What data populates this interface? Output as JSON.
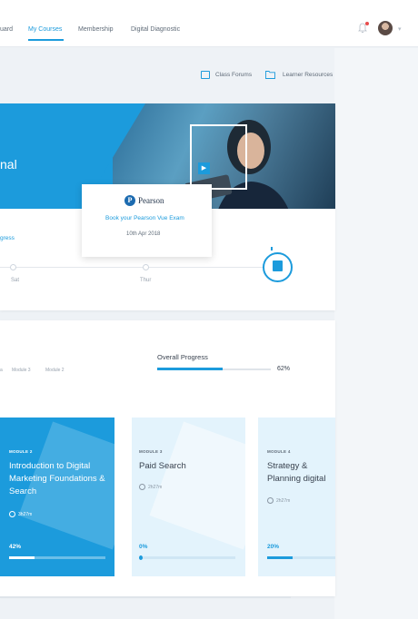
{
  "nav": {
    "items": [
      {
        "label": "uard",
        "active": false
      },
      {
        "label": "My Courses",
        "active": true
      },
      {
        "label": "Membership",
        "active": false
      },
      {
        "label": "Digital Diagnostic",
        "active": false
      }
    ]
  },
  "resources": {
    "class_forums": "Class Forums",
    "learner_resources": "Learner Resources"
  },
  "hero": {
    "title": "nal"
  },
  "exam_popup": {
    "brand": "Pearson",
    "link": "Book your Pearson Vue Exam",
    "date": "10th Apr 2018"
  },
  "timeline": {
    "label": "gress",
    "points": [
      "Sat",
      "Thur"
    ]
  },
  "overall": {
    "label": "Overall Progress",
    "value": 62,
    "percent": "62%",
    "tabs": [
      "Module 3",
      "Module 2"
    ]
  },
  "modules": [
    {
      "module": "MODULE 2",
      "title": "Introduction to Digital Marketing Foundations & Search",
      "duration": "3h27m",
      "percent": "42%",
      "progress": 0.42
    },
    {
      "module": "MODULE 3",
      "title": "Paid Search",
      "duration": "2h27m",
      "percent": "0%",
      "progress": 0.0
    },
    {
      "module": "MODULE 4",
      "title": "Strategy & Planning digital",
      "duration": "2h27m",
      "percent": "20%",
      "progress": 0.2
    }
  ],
  "colors": {
    "accent": "#1c9bdc",
    "light_card": "#e3f3fc"
  }
}
